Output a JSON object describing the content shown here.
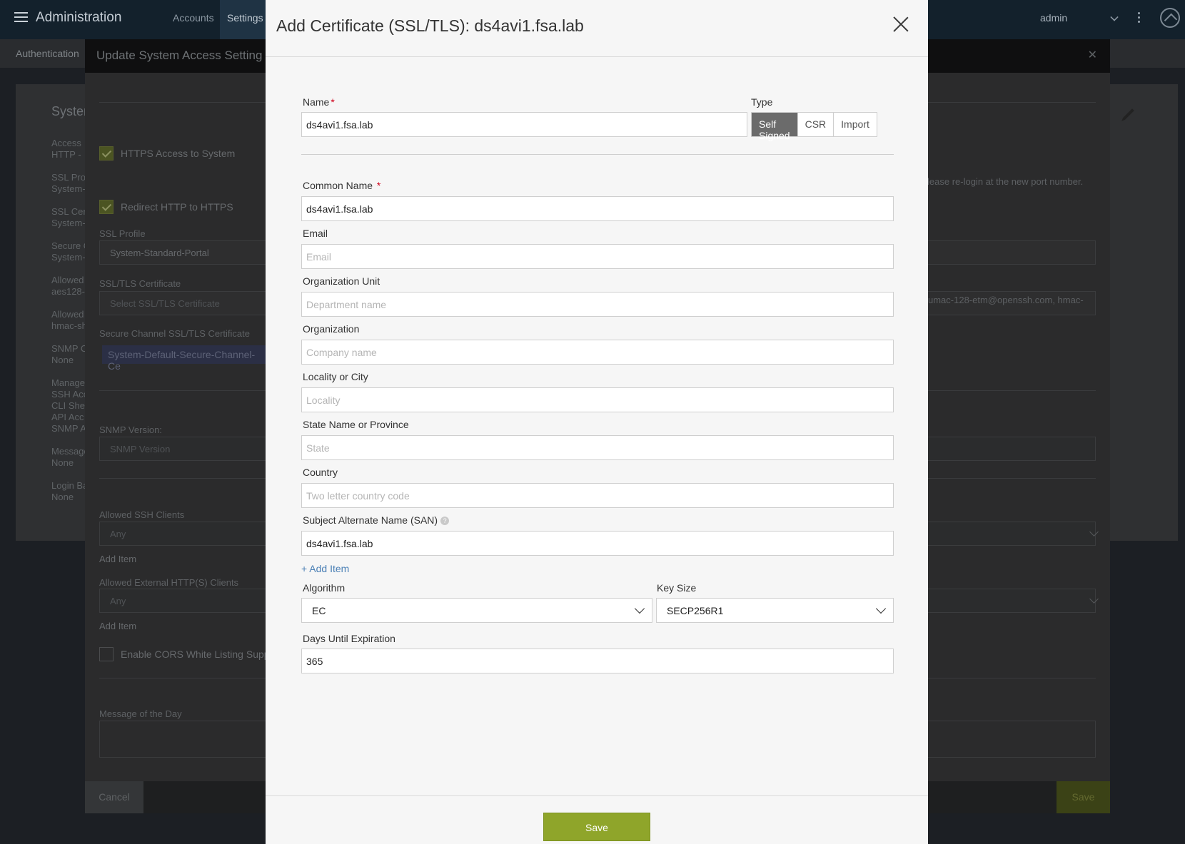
{
  "topbar": {
    "app_title": "Administration",
    "nav_accounts": "Accounts",
    "nav_settings": "Settings",
    "user": "admin"
  },
  "background_page": {
    "tab_auth": "Authentication",
    "title": "System",
    "summary": [
      "Access",
      "HTTP -",
      "SSL Pro",
      "System-",
      "SSL Cer",
      "System-",
      "Secure C",
      "System-",
      "Allowed",
      "aes128-",
      "Allowed",
      "hmac-sh",
      "SNMP C",
      "None",
      "Manage",
      "SSH Acc",
      "CLI She",
      "API Acc",
      "SNMP A",
      "Message",
      "None",
      "Login Ba",
      "None"
    ]
  },
  "access_modal": {
    "title": "Update System Access Setting",
    "https_access": "HTTPS Access to System",
    "redirect": "Redirect HTTP to HTTPS",
    "ssl_profile_label": "SSL Profile",
    "ssl_profile_value": "System-Standard-Portal",
    "ssl_cert_label": "SSL/TLS Certificate",
    "ssl_cert_placeholder": "Select SSL/TLS Certificate",
    "secure_channel_label": "Secure Channel SSL/TLS Certificate",
    "secure_channel_value": "System-Default-Secure-Channel-Ce",
    "snmp_version_label": "SNMP Version:",
    "snmp_version_placeholder": "SNMP Version",
    "ssh_clients_label": "Allowed SSH Clients",
    "ssh_clients_value": "Any",
    "add_item_1": "Add Item",
    "http_clients_label": "Allowed External HTTP(S) Clients",
    "http_clients_value": "Any",
    "add_item_2": "Add Item",
    "cors_label": "Enable CORS White Listing Suppo",
    "motd_label": "Message of the Day",
    "port_note": "lease re-login at the new port number.",
    "mac_value": "umac-128-etm@openssh.com, hmac-",
    "cancel": "Cancel",
    "save": "Save"
  },
  "modal": {
    "title": "Add Certificate (SSL/TLS): ds4avi1.fsa.lab",
    "name_label": "Name",
    "name_value": "ds4avi1.fsa.lab",
    "type_label": "Type",
    "type_options": [
      "Self Signed",
      "CSR",
      "Import"
    ],
    "type_selected": "Self Signed",
    "common_name_label": "Common Name",
    "common_name_value": "ds4avi1.fsa.lab",
    "email_label": "Email",
    "email_placeholder": "Email",
    "org_unit_label": "Organization Unit",
    "org_unit_placeholder": "Department name",
    "org_label": "Organization",
    "org_placeholder": "Company name",
    "locality_label": "Locality or City",
    "locality_placeholder": "Locality",
    "state_label": "State Name or Province",
    "state_placeholder": "State",
    "country_label": "Country",
    "country_placeholder": "Two letter country code",
    "san_label": "Subject Alternate Name (SAN)",
    "san_value": "ds4avi1.fsa.lab",
    "add_item": "+ Add Item",
    "algorithm_label": "Algorithm",
    "algorithm_value": "EC",
    "key_size_label": "Key Size",
    "key_size_value": "SECP256R1",
    "days_label": "Days Until Expiration",
    "days_value": "365",
    "save": "Save",
    "required_mark": "*"
  },
  "colors": {
    "accent_green": "#8fa52a",
    "topbar": "#13212c",
    "required": "#d0021b",
    "link": "#4a7fb5"
  }
}
